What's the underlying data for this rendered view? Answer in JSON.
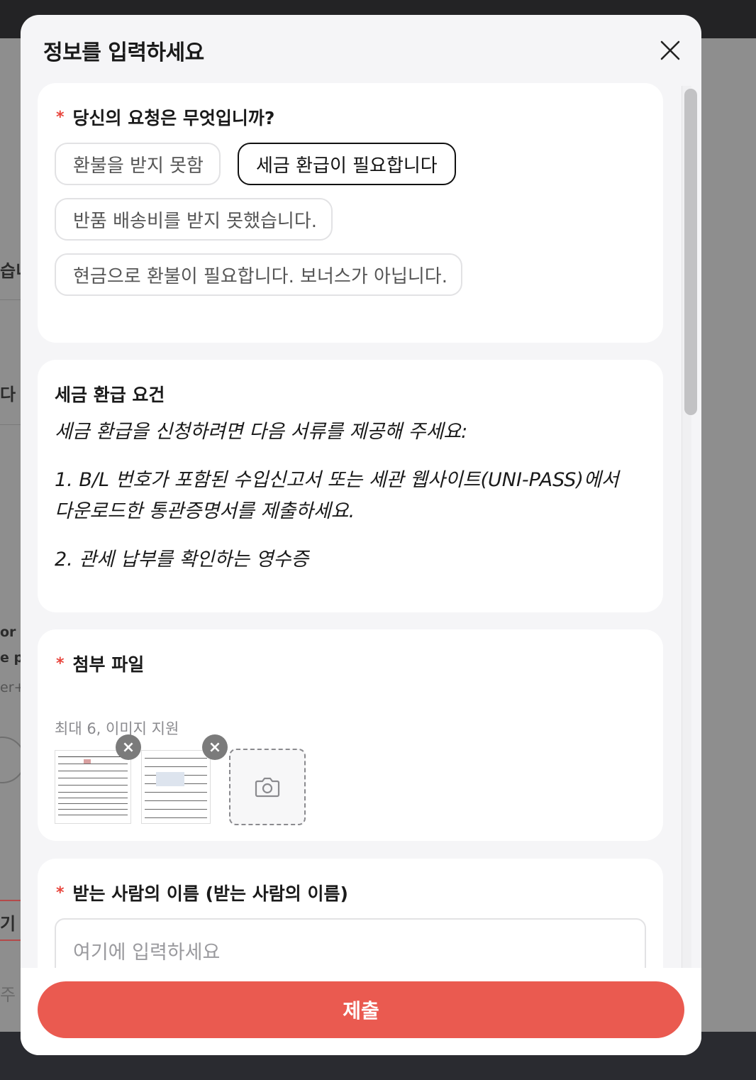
{
  "background": {
    "fragments": [
      "습니",
      "다",
      "or i",
      "e pl",
      "er+",
      "기",
      "주"
    ]
  },
  "modal": {
    "title": "정보를 입력하세요",
    "close_icon": "close-icon"
  },
  "request": {
    "label": "당신의 요청은 무엇입니까?",
    "required_mark": "*",
    "options": [
      "환불을 받지 못함",
      "세금 환급이 필요합니다",
      "반품 배송비를 받지 못했습니다.",
      "현금으로 환불이 필요합니다. 보너스가 아닙니다."
    ],
    "selected": "세금 환급이 필요합니다"
  },
  "requirements": {
    "title": "세금 환급 요건",
    "intro": "세금 환급을 신청하려면 다음 서류를 제공해 주세요:",
    "item1_line1": "1. B/L 번호가 포함된 수입신고서 또는 세관 웹사이트(UNI-PASS)에서",
    "item1_line2": "다운로드한 통관증명서를 제출하세요.",
    "item2": "2. 관세 납부를 확인하는 영수증"
  },
  "attachments": {
    "label": "첨부 파일",
    "required_mark": "*",
    "hint": "최대 6, 이미지 지원",
    "remove_icon": "×",
    "upload_icon": "camera-icon",
    "count": 2
  },
  "recipient": {
    "label": "받는 사람의 이름 (받는 사람의 이름)",
    "required_mark": "*",
    "placeholder": "여기에 입력하세요"
  },
  "footer": {
    "submit_label": "제출"
  },
  "colors": {
    "accent": "#ea5a50",
    "required": "#e8453c",
    "selected_border": "#111111"
  }
}
